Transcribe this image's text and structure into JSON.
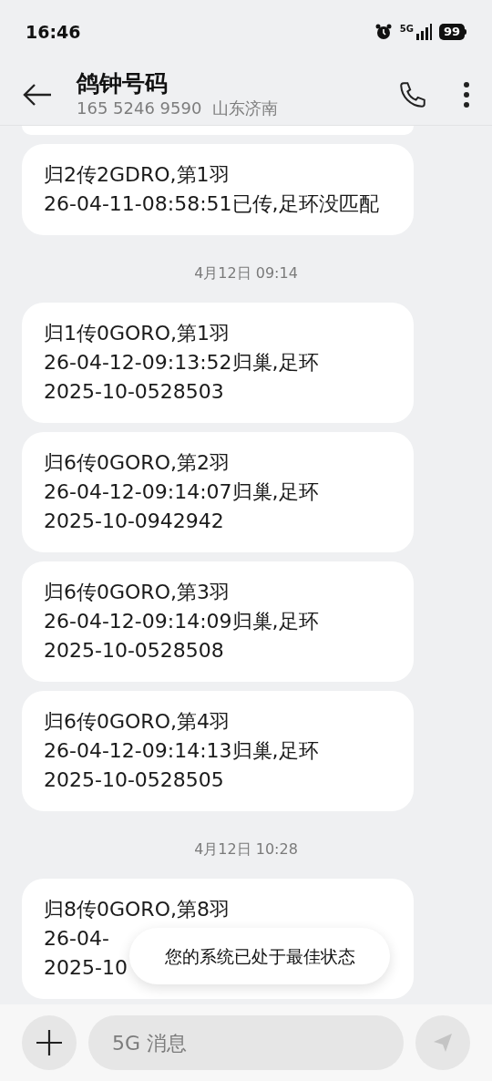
{
  "status_bar": {
    "time": "16:46",
    "network": "5G",
    "battery": "99"
  },
  "header": {
    "title": "鸽钟号码",
    "subtitle": "165 5246 9590  山东济南"
  },
  "feed": [
    {
      "kind": "message",
      "lines": [
        "归2传2GDRO,第1羽",
        "26-04-11-08:58:51已传,足环没匹配"
      ]
    },
    {
      "kind": "date",
      "text": "4月12日 09:14"
    },
    {
      "kind": "message",
      "lines": [
        "归1传0GORO,第1羽",
        "26-04-12-09:13:52归巢,足环",
        "2025-10-0528503"
      ]
    },
    {
      "kind": "message",
      "lines": [
        "归6传0GORO,第2羽",
        "26-04-12-09:14:07归巢,足环",
        "2025-10-0942942"
      ]
    },
    {
      "kind": "message",
      "lines": [
        "归6传0GORO,第3羽",
        "26-04-12-09:14:09归巢,足环",
        "2025-10-0528508"
      ]
    },
    {
      "kind": "message",
      "lines": [
        "归6传0GORO,第4羽",
        "26-04-12-09:14:13归巢,足环",
        "2025-10-0528505"
      ]
    },
    {
      "kind": "date",
      "text": "4月12日 10:28"
    },
    {
      "kind": "message",
      "lines": [
        "归8传0GORO,第8羽",
        "26-04-",
        "2025-10"
      ]
    }
  ],
  "toast": "您的系统已处于最佳状态",
  "composer": {
    "placeholder": "5G 消息"
  }
}
